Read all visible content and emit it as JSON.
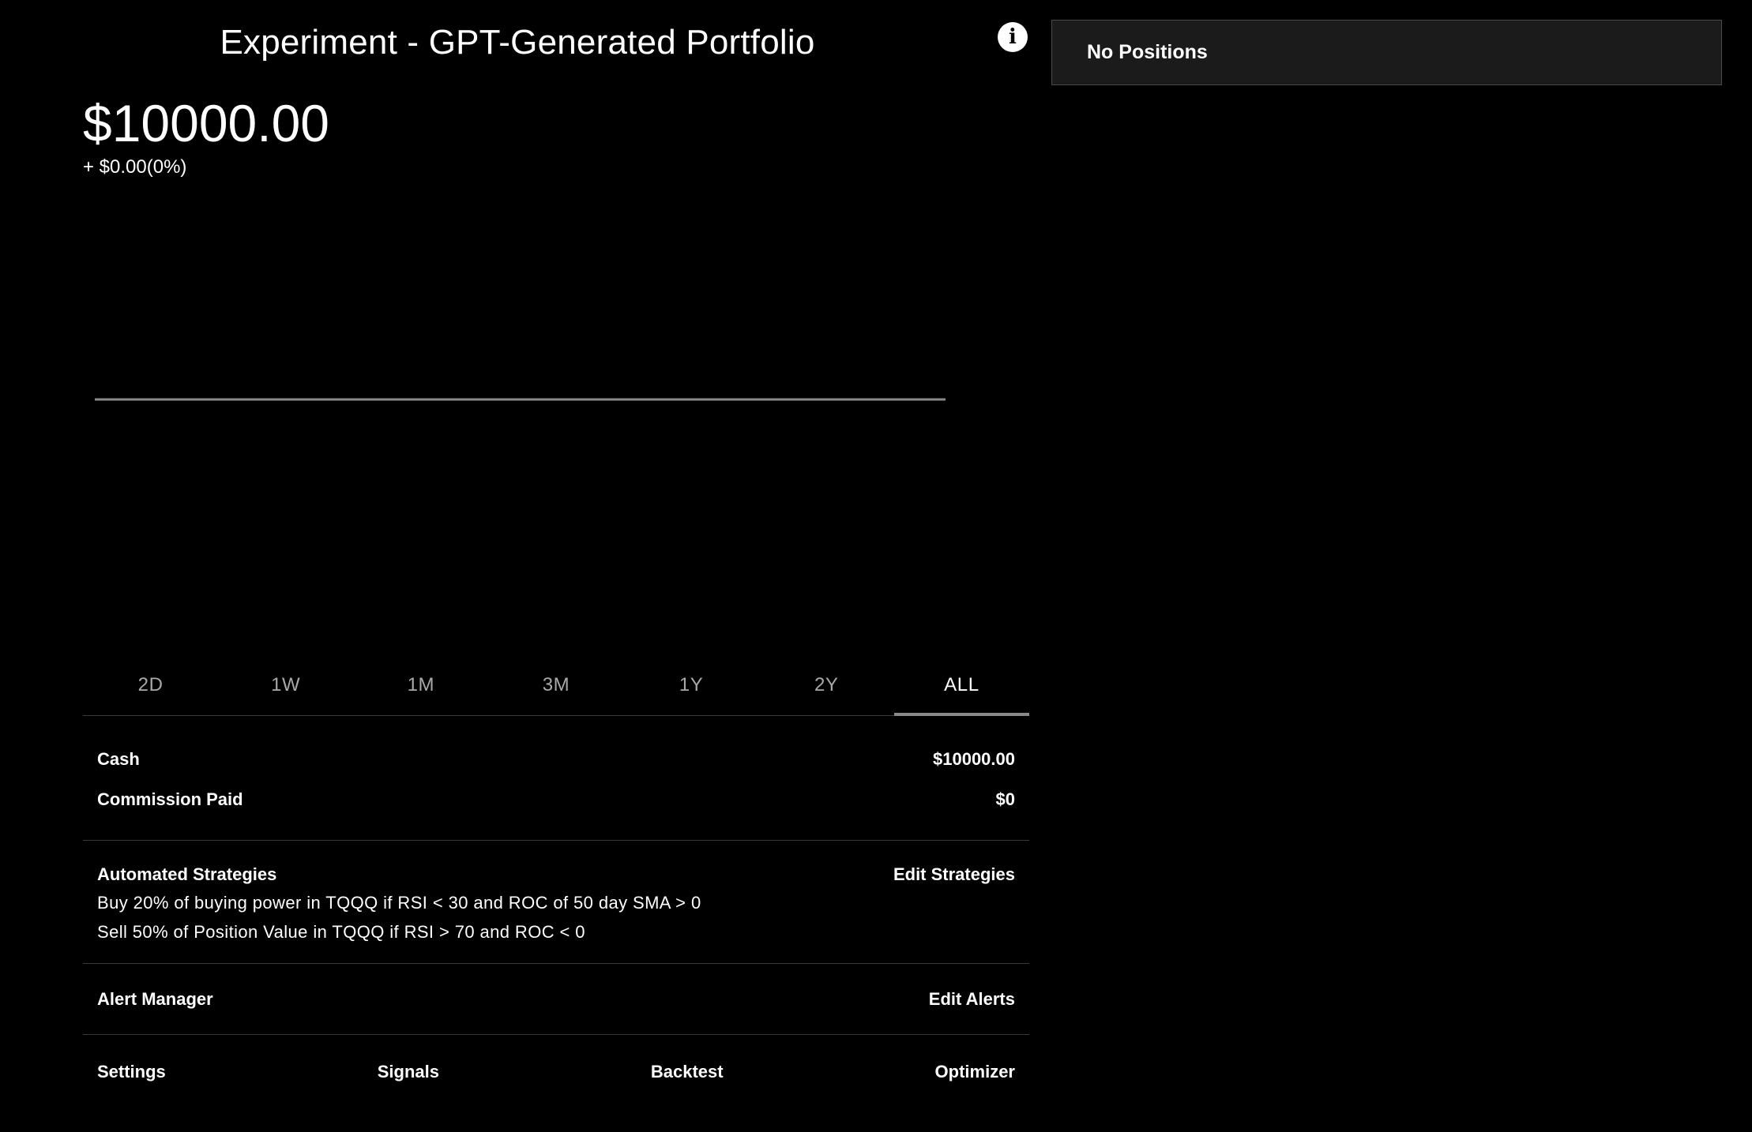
{
  "header": {
    "title": "Experiment - GPT-Generated Portfolio",
    "info_icon": "info-icon"
  },
  "summary": {
    "balance": "$10000.00",
    "change": "+ $0.00(0%)"
  },
  "range_tabs": [
    {
      "label": "2D",
      "active": false
    },
    {
      "label": "1W",
      "active": false
    },
    {
      "label": "1M",
      "active": false
    },
    {
      "label": "3M",
      "active": false
    },
    {
      "label": "1Y",
      "active": false
    },
    {
      "label": "2Y",
      "active": false
    },
    {
      "label": "ALL",
      "active": true
    }
  ],
  "account": {
    "cash_label": "Cash",
    "cash_value": "$10000.00",
    "commission_label": "Commission Paid",
    "commission_value": "$0"
  },
  "strategies": {
    "label": "Automated Strategies",
    "edit_label": "Edit Strategies",
    "items": [
      "Buy 20% of buying power in TQQQ if RSI < 30 and ROC of 50 day SMA > 0",
      "Sell 50% of Position Value in TQQQ if RSI > 70 and ROC < 0"
    ]
  },
  "alerts": {
    "label": "Alert Manager",
    "edit_label": "Edit Alerts"
  },
  "bottom_nav": {
    "settings": "Settings",
    "signals": "Signals",
    "backtest": "Backtest",
    "optimizer": "Optimizer"
  },
  "positions": {
    "empty_label": "No Positions"
  },
  "colors": {
    "background": "#000000",
    "chart_line": "#8a8a8a",
    "panel": "#1b1b1b",
    "divider": "#3a3a3a"
  },
  "chart_data": {
    "type": "line",
    "series": [
      {
        "values": [
          10000,
          10000
        ]
      }
    ]
  }
}
